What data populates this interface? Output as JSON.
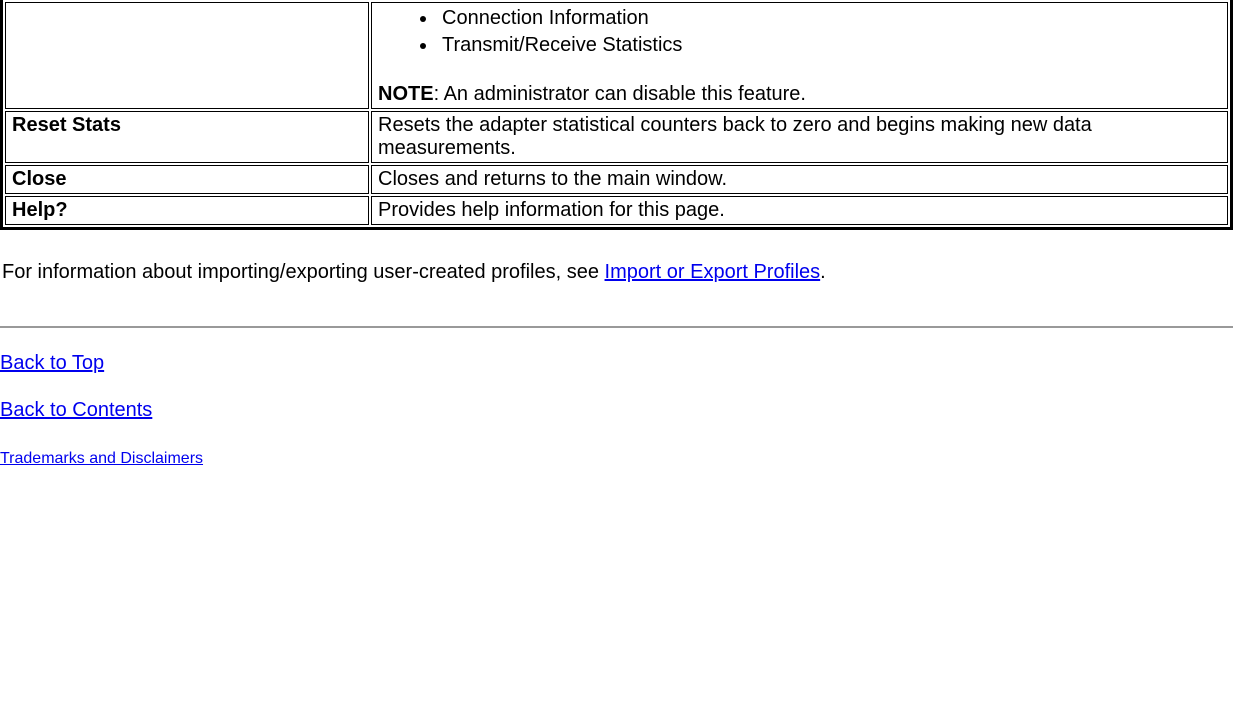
{
  "table": {
    "row0": {
      "bullets": [
        "Connection Information",
        "Transmit/Receive Statistics"
      ],
      "noteLabel": "NOTE",
      "noteText": ": An administrator can disable this feature."
    },
    "row1": {
      "label": "Reset Stats",
      "desc": "Resets the adapter statistical counters back to zero and begins making new data measurements."
    },
    "row2": {
      "label": "Close",
      "desc": "Closes and returns to the main window."
    },
    "row3": {
      "label": "Help?",
      "desc": "Provides help information for this page."
    }
  },
  "paragraph": {
    "prefix": "For information about importing/exporting user-created profiles, see ",
    "linkText": "Import or Export Profiles",
    "suffix": "."
  },
  "footerLinks": {
    "backToTop": "Back to Top",
    "backToContents": "Back to Contents",
    "trademarks": "Trademarks and Disclaimers"
  }
}
